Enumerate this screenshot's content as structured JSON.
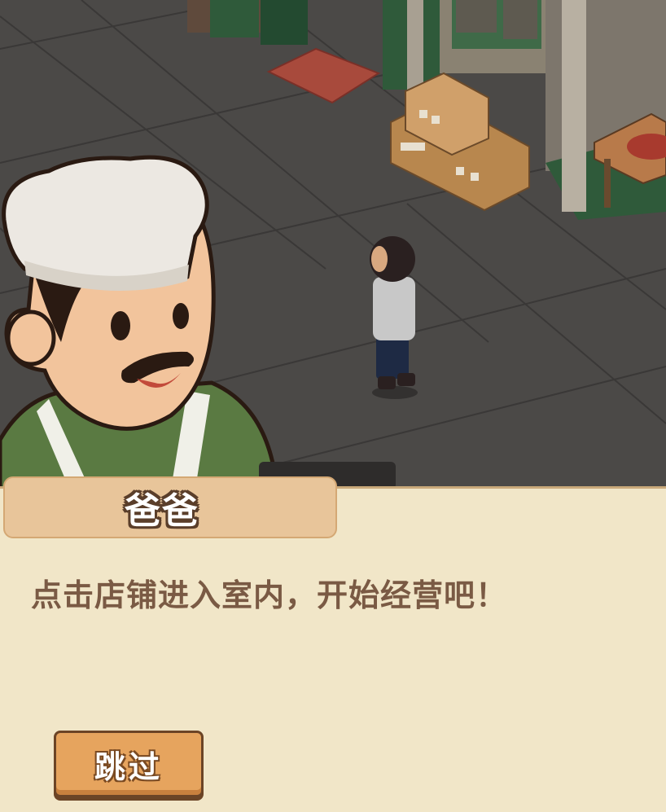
{
  "dialog": {
    "speaker": "爸爸",
    "text": "点击店铺进入室内，开始经营吧！",
    "skip_label": "跳过"
  },
  "colors": {
    "dialog_bg": "#f1e6c8",
    "name_plate": "#e8c59a",
    "skip_button": "#e6a45e",
    "text_brown": "#7a5a44",
    "floor": "#4a4846"
  },
  "icons": [
    "chef-dad-portrait",
    "player-character",
    "shop-boxes",
    "doormat"
  ]
}
